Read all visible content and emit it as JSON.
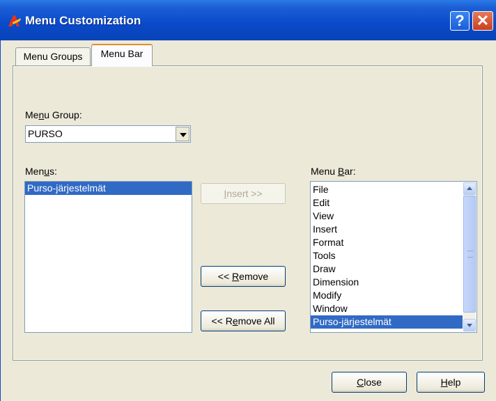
{
  "window": {
    "title": "Menu Customization",
    "help_glyph": "?",
    "close_glyph": "✕"
  },
  "tabs": [
    {
      "label": "Menu Groups"
    },
    {
      "label": "Menu Bar"
    }
  ],
  "menu_group": {
    "label_pre": "Me",
    "label_u": "n",
    "label_post": "u Group:",
    "value": "PURSO"
  },
  "menus": {
    "label_pre": "Men",
    "label_u": "u",
    "label_post": "s:",
    "items": [
      "Purso-järjestelmät"
    ]
  },
  "menu_bar": {
    "label_pre": "Menu ",
    "label_u": "B",
    "label_post": "ar:",
    "items": [
      "File",
      "Edit",
      "View",
      "Insert",
      "Format",
      "Tools",
      "Draw",
      "Dimension",
      "Modify",
      "Window",
      "Purso-järjestelmät"
    ]
  },
  "buttons": {
    "insert": {
      "u": "I",
      "rest": "nsert >>"
    },
    "remove": {
      "pre": "<< ",
      "u": "R",
      "rest": "emove"
    },
    "remove_all": {
      "pre": "<< R",
      "u": "e",
      "rest": "move All"
    },
    "close": {
      "u": "C",
      "rest": "lose"
    },
    "help": {
      "u": "H",
      "rest": "elp"
    }
  },
  "colors": {
    "title_bar": "#0a49c9",
    "selection": "#316ac5",
    "active_tab_accent": "#e68b2c"
  }
}
